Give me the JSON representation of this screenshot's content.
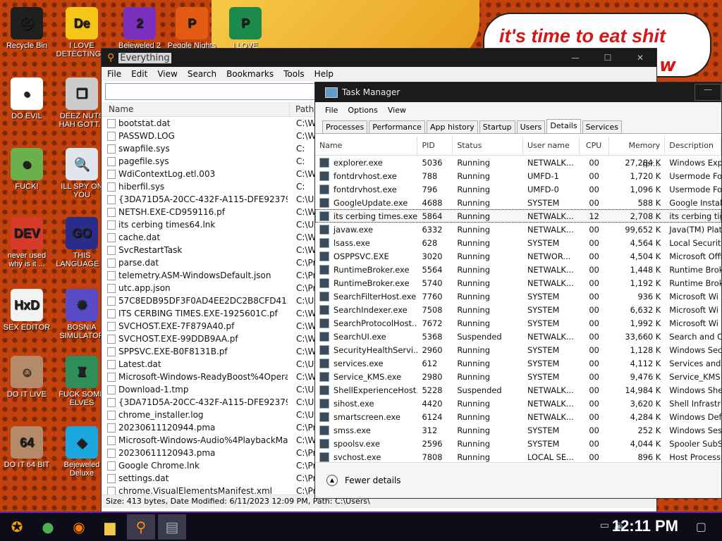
{
  "wallpaper": {
    "caption_line1": "it's time to eat shit",
    "caption_line2": "w"
  },
  "desktop_icons": [
    {
      "label": "Recycle Bin",
      "color": "#1f1f1f",
      "glyph": "⛑"
    },
    {
      "label": "I LOVE DETECTING...",
      "color": "#f5c518",
      "glyph": "De"
    },
    {
      "label": "Bejeweled 2",
      "color": "#7b2fbf",
      "glyph": "2"
    },
    {
      "label": "Peggle Nights",
      "color": "#e35b13",
      "glyph": "P"
    },
    {
      "label": "I LOVE",
      "color": "#1c8a4a",
      "glyph": "P"
    },
    {
      "label": "DO EVIL",
      "color": "#ffffff",
      "glyph": "●"
    },
    {
      "label": "DEEZ NUTS HAH GOTT...",
      "color": "#cccccc",
      "glyph": "❐"
    },
    {
      "label": "FUCK!",
      "color": "#6ab04c",
      "glyph": "☻"
    },
    {
      "label": "ILL SPY ON YOU",
      "color": "#dfe6ee",
      "glyph": "🔍"
    },
    {
      "label": "never used why is it ...",
      "color": "#d83a2a",
      "glyph": "DEV"
    },
    {
      "label": "THIS LANGUAGE ...",
      "color": "#2b2b8a",
      "glyph": "GO"
    },
    {
      "label": "SEX EDITOR",
      "color": "#f2f2f2",
      "glyph": "HxD"
    },
    {
      "label": "BOSNIA SIMULATOR",
      "color": "#5a4ac7",
      "glyph": "✹"
    },
    {
      "label": "DO IT LIVE",
      "color": "#b48a6a",
      "glyph": "☺"
    },
    {
      "label": "FUCK SOME ELVES",
      "color": "#2f8f5a",
      "glyph": "♜"
    },
    {
      "label": "DO IT 64 BIT",
      "color": "#b48a6a",
      "glyph": "64"
    },
    {
      "label": "Bejeweled Deluxe",
      "color": "#1aa7e0",
      "glyph": "◆"
    }
  ],
  "everything": {
    "title": "Everything",
    "menu": [
      "File",
      "Edit",
      "View",
      "Search",
      "Bookmarks",
      "Tools",
      "Help"
    ],
    "search_value": "",
    "col_name": "Name",
    "col_path": "Path",
    "rows": [
      {
        "name": "bootstat.dat",
        "path": "C:\\Wind"
      },
      {
        "name": "PASSWD.LOG",
        "path": "C:\\Wind"
      },
      {
        "name": "swapfile.sys",
        "path": "C:"
      },
      {
        "name": "pagefile.sys",
        "path": "C:"
      },
      {
        "name": "WdiContextLog.etl.003",
        "path": "C:\\Wind"
      },
      {
        "name": "hiberfil.sys",
        "path": "C:"
      },
      {
        "name": "{3DA71D5A-20CC-432F-A115-DFE92379E91F}...",
        "path": "C:\\User"
      },
      {
        "name": "NETSH.EXE-CD959116.pf",
        "path": "C:\\Wind"
      },
      {
        "name": "its cerbing times64.lnk",
        "path": "C:\\User"
      },
      {
        "name": "cache.dat",
        "path": "C:\\Wind"
      },
      {
        "name": "SvcRestartTask",
        "path": "C:\\Wind"
      },
      {
        "name": "parse.dat",
        "path": "C:\\Prog"
      },
      {
        "name": "telemetry.ASM-WindowsDefault.json",
        "path": "C:\\Prog"
      },
      {
        "name": "utc.app.json",
        "path": "C:\\Prog"
      },
      {
        "name": "57C8EDB95DF3F0AD4EE2DC2B8CFD4157",
        "path": "C:\\User"
      },
      {
        "name": "ITS CERBING TIMES.EXE-1925601C.pf",
        "path": "C:\\Wind"
      },
      {
        "name": "SVCHOST.EXE-7F879A40.pf",
        "path": "C:\\Wind"
      },
      {
        "name": "SVCHOST.EXE-99DDB9AA.pf",
        "path": "C:\\Wind"
      },
      {
        "name": "SPPSVC.EXE-B0F8131B.pf",
        "path": "C:\\Wind"
      },
      {
        "name": "Latest.dat",
        "path": "C:\\User"
      },
      {
        "name": "Microsoft-Windows-ReadyBoost%4Operational...",
        "path": "C:\\Wind"
      },
      {
        "name": "Download-1.tmp",
        "path": "C:\\User"
      },
      {
        "name": "{3DA71D5A-20CC-432F-A115-DFE92379E91F}...",
        "path": "C:\\User"
      },
      {
        "name": "chrome_installer.log",
        "path": "C:\\User"
      },
      {
        "name": "20230611120944.pma",
        "path": "C:\\Prog"
      },
      {
        "name": "Microsoft-Windows-Audio%4PlaybackManager...",
        "path": "C:\\Wind"
      },
      {
        "name": "20230611120943.pma",
        "path": "C:\\Prog"
      },
      {
        "name": "Google Chrome.lnk",
        "path": "C:\\Prog"
      },
      {
        "name": "settings.dat",
        "path": "C:\\Prog"
      },
      {
        "name": "chrome.VisualElementsManifest.xml",
        "path": "C:\\Prog"
      }
    ],
    "status": "Size: 413 bytes, Date Modified: 6/11/2023 12:09 PM, Path: C:\\Users\\"
  },
  "taskmgr": {
    "title": "Task Manager",
    "menu": [
      "File",
      "Options",
      "View"
    ],
    "tabs": [
      "Processes",
      "Performance",
      "App history",
      "Startup",
      "Users",
      "Details",
      "Services"
    ],
    "active_tab": "Details",
    "headers": {
      "name": "Name",
      "pid": "PID",
      "status": "Status",
      "user": "User name",
      "cpu": "CPU",
      "mem": "Memory (pr...",
      "desc": "Description"
    },
    "rows": [
      {
        "name": "explorer.exe",
        "pid": "5036",
        "status": "Running",
        "user": "NETWALK...",
        "cpu": "00",
        "mem": "27,284 K",
        "desc": "Windows Expl"
      },
      {
        "name": "fontdrvhost.exe",
        "pid": "788",
        "status": "Running",
        "user": "UMFD-1",
        "cpu": "00",
        "mem": "1,720 K",
        "desc": "Usermode Fon"
      },
      {
        "name": "fontdrvhost.exe",
        "pid": "796",
        "status": "Running",
        "user": "UMFD-0",
        "cpu": "00",
        "mem": "1,096 K",
        "desc": "Usermode Fon"
      },
      {
        "name": "GoogleUpdate.exe",
        "pid": "4688",
        "status": "Running",
        "user": "SYSTEM",
        "cpu": "00",
        "mem": "588 K",
        "desc": "Google Instal"
      },
      {
        "name": "its cerbing times.exe",
        "pid": "5864",
        "status": "Running",
        "user": "NETWALK...",
        "cpu": "12",
        "mem": "2,708 K",
        "desc": "its cerbing tin"
      },
      {
        "name": "javaw.exe",
        "pid": "6332",
        "status": "Running",
        "user": "NETWALK...",
        "cpu": "00",
        "mem": "99,652 K",
        "desc": "Java(TM) Plat"
      },
      {
        "name": "lsass.exe",
        "pid": "628",
        "status": "Running",
        "user": "SYSTEM",
        "cpu": "00",
        "mem": "4,564 K",
        "desc": "Local Securit"
      },
      {
        "name": "OSPPSVC.EXE",
        "pid": "3020",
        "status": "Running",
        "user": "NETWOR...",
        "cpu": "00",
        "mem": "4,504 K",
        "desc": "Microsoft Offi"
      },
      {
        "name": "RuntimeBroker.exe",
        "pid": "5564",
        "status": "Running",
        "user": "NETWALK...",
        "cpu": "00",
        "mem": "1,448 K",
        "desc": "Runtime Brok"
      },
      {
        "name": "RuntimeBroker.exe",
        "pid": "5740",
        "status": "Running",
        "user": "NETWALK...",
        "cpu": "00",
        "mem": "1,192 K",
        "desc": "Runtime Brok"
      },
      {
        "name": "SearchFilterHost.exe",
        "pid": "7760",
        "status": "Running",
        "user": "SYSTEM",
        "cpu": "00",
        "mem": "936 K",
        "desc": "Microsoft Wi"
      },
      {
        "name": "SearchIndexer.exe",
        "pid": "7508",
        "status": "Running",
        "user": "SYSTEM",
        "cpu": "00",
        "mem": "6,632 K",
        "desc": "Microsoft Wi"
      },
      {
        "name": "SearchProtocolHost....",
        "pid": "7672",
        "status": "Running",
        "user": "SYSTEM",
        "cpu": "00",
        "mem": "1,992 K",
        "desc": "Microsoft Wi"
      },
      {
        "name": "SearchUI.exe",
        "pid": "5368",
        "status": "Suspended",
        "user": "NETWALK...",
        "cpu": "00",
        "mem": "33,660 K",
        "desc": "Search and C"
      },
      {
        "name": "SecurityHealthServi...",
        "pid": "2960",
        "status": "Running",
        "user": "SYSTEM",
        "cpu": "00",
        "mem": "1,128 K",
        "desc": "Windows Sec"
      },
      {
        "name": "services.exe",
        "pid": "612",
        "status": "Running",
        "user": "SYSTEM",
        "cpu": "00",
        "mem": "4,112 K",
        "desc": "Services and"
      },
      {
        "name": "Service_KMS.exe",
        "pid": "2980",
        "status": "Running",
        "user": "SYSTEM",
        "cpu": "00",
        "mem": "9,476 K",
        "desc": "Service_KMS"
      },
      {
        "name": "ShellExperienceHost...",
        "pid": "5228",
        "status": "Suspended",
        "user": "NETWALK...",
        "cpu": "00",
        "mem": "14,984 K",
        "desc": "Windows She"
      },
      {
        "name": "sihost.exe",
        "pid": "4420",
        "status": "Running",
        "user": "NETWALK...",
        "cpu": "00",
        "mem": "3,620 K",
        "desc": "Shell Infrastr"
      },
      {
        "name": "smartscreen.exe",
        "pid": "6124",
        "status": "Running",
        "user": "NETWALK...",
        "cpu": "00",
        "mem": "4,284 K",
        "desc": "Windows Def"
      },
      {
        "name": "smss.exe",
        "pid": "312",
        "status": "Running",
        "user": "SYSTEM",
        "cpu": "00",
        "mem": "252 K",
        "desc": "Windows Ses"
      },
      {
        "name": "spoolsv.exe",
        "pid": "2596",
        "status": "Running",
        "user": "SYSTEM",
        "cpu": "00",
        "mem": "4,044 K",
        "desc": "Spooler SubS"
      },
      {
        "name": "svchost.exe",
        "pid": "7808",
        "status": "Running",
        "user": "LOCAL SE...",
        "cpu": "00",
        "mem": "896 K",
        "desc": "Host Process"
      }
    ],
    "selected_index": 4,
    "fewer_details": "Fewer details"
  },
  "taskbar": {
    "clock": "12:11 PM",
    "apps": [
      {
        "name": "start",
        "glyph": "✪",
        "color": "#f39c12"
      },
      {
        "name": "chrome",
        "glyph": "●",
        "color": "#4caf50"
      },
      {
        "name": "firefox",
        "glyph": "◉",
        "color": "#ff7a00"
      },
      {
        "name": "explorer",
        "glyph": "▆",
        "color": "#f2c94c"
      },
      {
        "name": "everything",
        "glyph": "⚲",
        "color": "#ff8c1a"
      },
      {
        "name": "taskmgr",
        "glyph": "▤",
        "color": "#9ab"
      }
    ]
  }
}
